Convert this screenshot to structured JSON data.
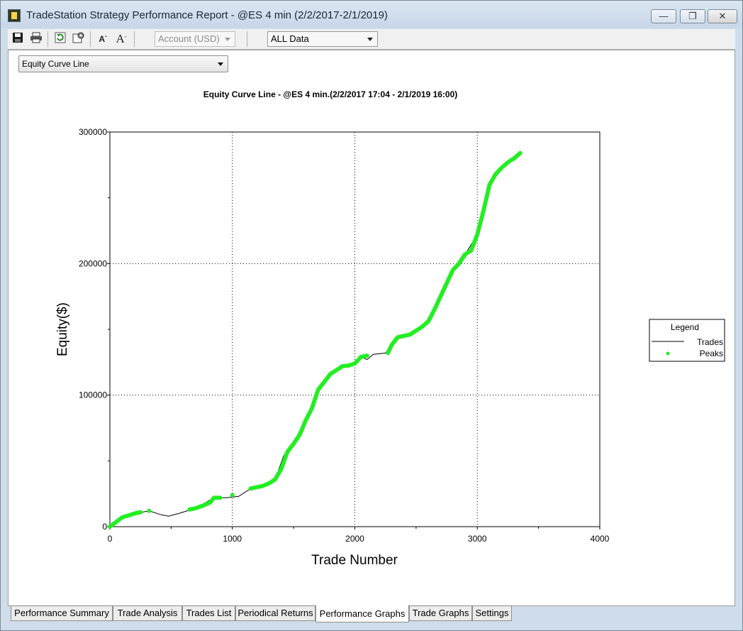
{
  "window": {
    "title": "TradeStation Strategy Performance Report - @ES 4 min (2/2/2017-2/1/2019)",
    "minimize_glyph": "—",
    "restore_glyph": "❐",
    "close_glyph": "✕"
  },
  "toolbar": {
    "icons": [
      "save-icon",
      "print-icon",
      "refresh-icon",
      "properties-icon",
      "decrease-font-icon",
      "increase-font-icon"
    ],
    "account_combo": "Account (USD)",
    "data_range_combo": "ALL Data"
  },
  "graph_selector": {
    "value": "Equity Curve Line"
  },
  "tabs": [
    {
      "label": "Performance Summary",
      "active": false
    },
    {
      "label": "Trade Analysis",
      "active": false
    },
    {
      "label": "Trades List",
      "active": false
    },
    {
      "label": "Periodical Returns",
      "active": false
    },
    {
      "label": "Performance Graphs",
      "active": true
    },
    {
      "label": "Trade Graphs",
      "active": false
    },
    {
      "label": "Settings",
      "active": false
    }
  ],
  "colors": {
    "peaks": "#22ee22",
    "line": "#000000"
  },
  "chart_data": {
    "type": "line",
    "title": "Equity Curve Line - @ES 4 min.(2/2/2017 17:04 - 2/1/2019 16:00)",
    "xlabel": "Trade Number",
    "ylabel": "Equity($)",
    "xlim": [
      0,
      4000
    ],
    "ylim": [
      0,
      300000
    ],
    "x_ticks": [
      "0",
      "1000",
      "2000",
      "3000",
      "4000"
    ],
    "y_ticks": [
      "0",
      "100000",
      "200000",
      "300000"
    ],
    "grid": "dotted",
    "legend": {
      "title": "Legend",
      "placement": "right",
      "entries": [
        "Trades",
        "Peaks"
      ]
    },
    "series": [
      {
        "name": "Trades",
        "x": [
          0,
          100,
          200,
          320,
          420,
          480,
          560,
          700,
          850,
          950,
          1050,
          1150,
          1250,
          1350,
          1420,
          1500,
          1600,
          1700,
          1800,
          1900,
          2000,
          2050,
          2100,
          2150,
          2250,
          2350,
          2450,
          2550,
          2600,
          2700,
          2800,
          2900,
          3000,
          3100,
          3200,
          3300,
          3350
        ],
        "y": [
          0,
          7000,
          10000,
          12000,
          9000,
          8000,
          10000,
          14000,
          22000,
          22000,
          23000,
          29000,
          31000,
          36000,
          54000,
          64000,
          81000,
          104000,
          116000,
          122000,
          124000,
          129000,
          127000,
          131000,
          132000,
          144000,
          147000,
          152000,
          158000,
          175000,
          195000,
          207000,
          222000,
          260000,
          273000,
          280000,
          284000
        ]
      },
      {
        "name": "Peaks",
        "x": [
          0,
          50,
          100,
          150,
          200,
          250,
          320,
          650,
          700,
          760,
          820,
          850,
          900,
          1000,
          1150,
          1200,
          1250,
          1300,
          1350,
          1400,
          1450,
          1500,
          1550,
          1600,
          1650,
          1700,
          1750,
          1800,
          1850,
          1900,
          1950,
          2000,
          2050,
          2100,
          2270,
          2300,
          2350,
          2400,
          2450,
          2500,
          2550,
          2600,
          2650,
          2700,
          2750,
          2800,
          2850,
          2900,
          2950,
          3000,
          3050,
          3100,
          3150,
          3200,
          3250,
          3300,
          3350
        ],
        "y": [
          0,
          3500,
          7000,
          8500,
          10000,
          11000,
          12000,
          13000,
          14000,
          16000,
          18500,
          22000,
          22000,
          24000,
          29000,
          30000,
          31000,
          33000,
          36000,
          44000,
          57000,
          63000,
          70000,
          81000,
          90000,
          104000,
          110000,
          116000,
          119000,
          122000,
          122500,
          124000,
          129000,
          130000,
          132000,
          138000,
          144000,
          145000,
          146000,
          149000,
          152000,
          156000,
          165000,
          175000,
          185000,
          195000,
          200000,
          207000,
          210000,
          222000,
          240000,
          260000,
          268000,
          273000,
          277000,
          280000,
          284000
        ]
      }
    ]
  }
}
